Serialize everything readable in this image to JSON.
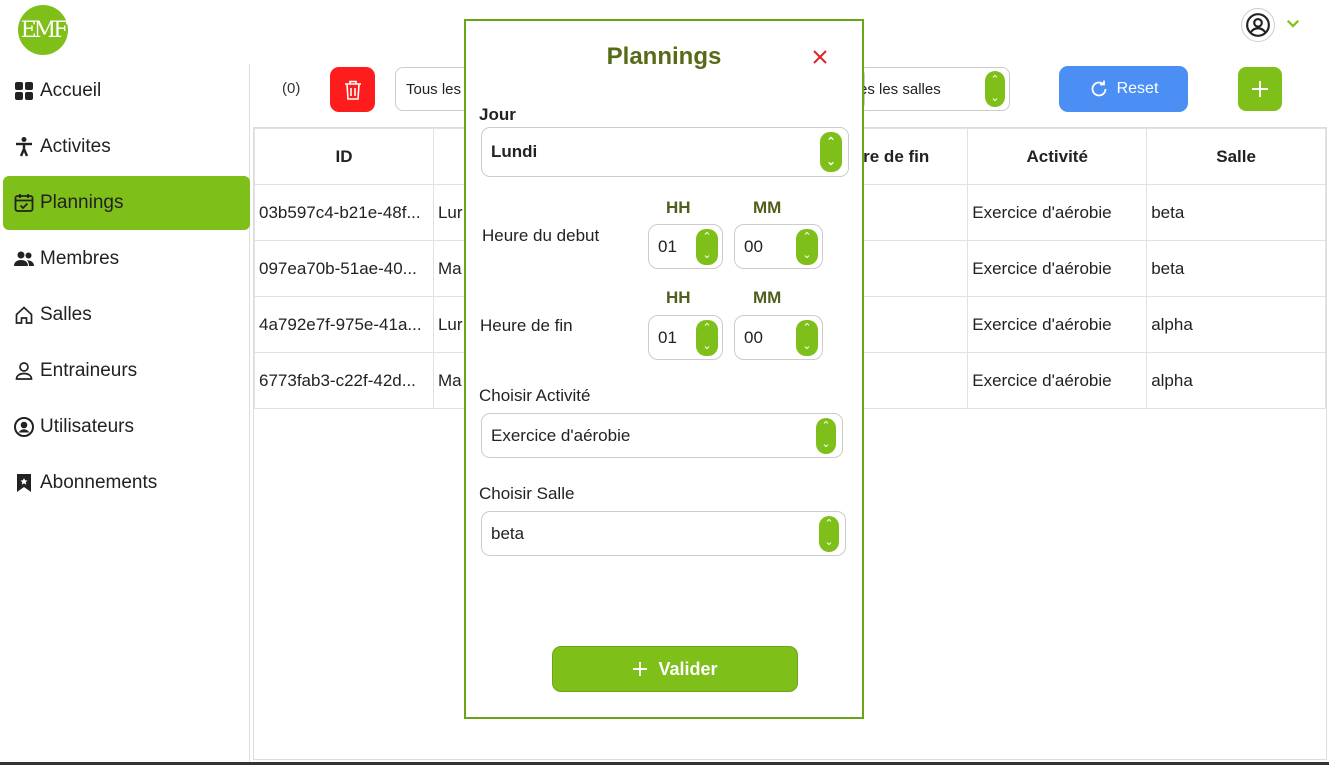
{
  "logo": {
    "text": "EMF"
  },
  "sidebar": {
    "items": [
      {
        "label": "Accueil",
        "icon": "grid-icon"
      },
      {
        "label": "Activites",
        "icon": "person-icon"
      },
      {
        "label": "Plannings",
        "icon": "calendar-icon",
        "active": true
      },
      {
        "label": "Membres",
        "icon": "users-icon"
      },
      {
        "label": "Salles",
        "icon": "home-icon"
      },
      {
        "label": "Entraineurs",
        "icon": "user-outline-icon"
      },
      {
        "label": "Utilisateurs",
        "icon": "user-circle-icon"
      },
      {
        "label": "Abonnements",
        "icon": "bookmark-icon"
      }
    ]
  },
  "toolbar": {
    "count": "(0)",
    "filter_day": "Tous les",
    "filter_room": "es les salles",
    "reset_label": "Reset"
  },
  "table": {
    "headers": [
      "ID",
      "",
      "re de fin",
      "Activité",
      "Salle"
    ],
    "rows": [
      [
        "03b597c4-b21e-48f...",
        "Lur",
        "",
        "Exercice d'aérobie",
        "beta"
      ],
      [
        "097ea70b-51ae-40...",
        "Ma",
        "",
        "Exercice d'aérobie",
        "beta"
      ],
      [
        "4a792e7f-975e-41a...",
        "Lur",
        "",
        "Exercice d'aérobie",
        "alpha"
      ],
      [
        "6773fab3-c22f-42d...",
        "Ma",
        "",
        "Exercice d'aérobie",
        "alpha"
      ]
    ]
  },
  "modal": {
    "title": "Plannings",
    "jour_label": "Jour",
    "jour_value": "Lundi",
    "start_label": "Heure du debut",
    "end_label": "Heure de fin",
    "hh_label": "HH",
    "mm_label": "MM",
    "start_hh": "01",
    "start_mm": "00",
    "end_hh": "01",
    "end_mm": "00",
    "activite_label": "Choisir Activité",
    "activite_value": "Exercice d'aérobie",
    "salle_label": "Choisir Salle",
    "salle_value": "beta",
    "submit_label": "Valider"
  },
  "colors": {
    "accent": "#7fbf1a",
    "danger": "#ff1c1c",
    "primary": "#4b8ff5",
    "title": "#556b18"
  }
}
